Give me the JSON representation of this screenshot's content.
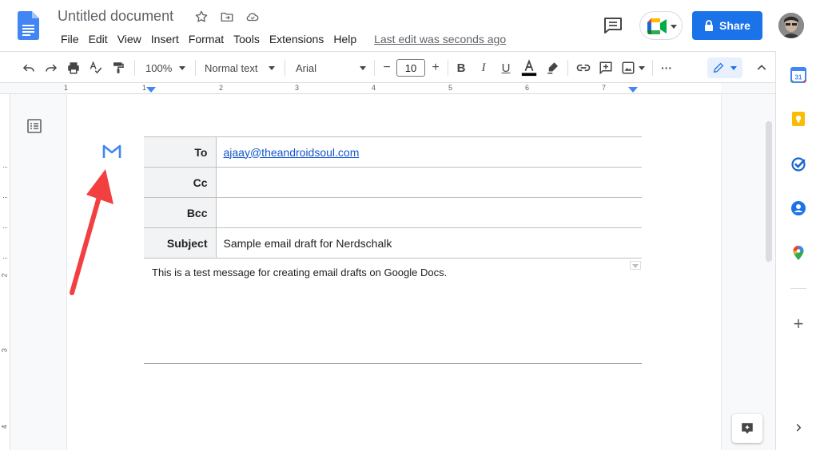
{
  "document": {
    "title": "Untitled document",
    "last_edit": "Last edit was seconds ago"
  },
  "menu": [
    "File",
    "Edit",
    "View",
    "Insert",
    "Format",
    "Tools",
    "Extensions",
    "Help"
  ],
  "header": {
    "share_label": "Share"
  },
  "toolbar": {
    "zoom": "100%",
    "style": "Normal text",
    "font": "Arial",
    "font_size": "10",
    "decrease": "−",
    "increase": "+",
    "bold": "B",
    "italic": "I",
    "underline": "U",
    "more": "···"
  },
  "ruler": {
    "h_numbers": [
      "1",
      "1",
      "2",
      "3",
      "4",
      "5",
      "6",
      "7"
    ],
    "v_numbers": [
      "1",
      "2",
      "3",
      "4"
    ]
  },
  "email": {
    "to_label": "To",
    "to_value": "ajaay@theandroidsoul.com",
    "cc_label": "Cc",
    "cc_value": "",
    "bcc_label": "Bcc",
    "bcc_value": "",
    "subject_label": "Subject",
    "subject_value": "Sample email draft for Nerdschalk",
    "body": "This is a test message for creating email drafts on Google Docs."
  },
  "side_panel": {
    "calendar_day": "31",
    "add": "+"
  },
  "colors": {
    "accent": "#1a73e8",
    "arrow": "#f23f3f",
    "link": "#1155cc"
  },
  "icons": [
    "docs-logo-icon",
    "star-icon",
    "move-folder-icon",
    "cloud-icon",
    "comments-icon",
    "meet-icon",
    "lock-icon",
    "undo-icon",
    "redo-icon",
    "print-icon",
    "spellcheck-icon",
    "paint-format-icon",
    "text-color-icon",
    "highlight-icon",
    "link-icon",
    "add-comment-icon",
    "image-icon",
    "pencil-icon",
    "chevron-up-icon",
    "outline-icon",
    "gmail-icon",
    "calendar-icon",
    "keep-icon",
    "tasks-icon",
    "contacts-icon",
    "maps-icon",
    "plus-icon",
    "chevron-right-icon",
    "explore-icon"
  ]
}
